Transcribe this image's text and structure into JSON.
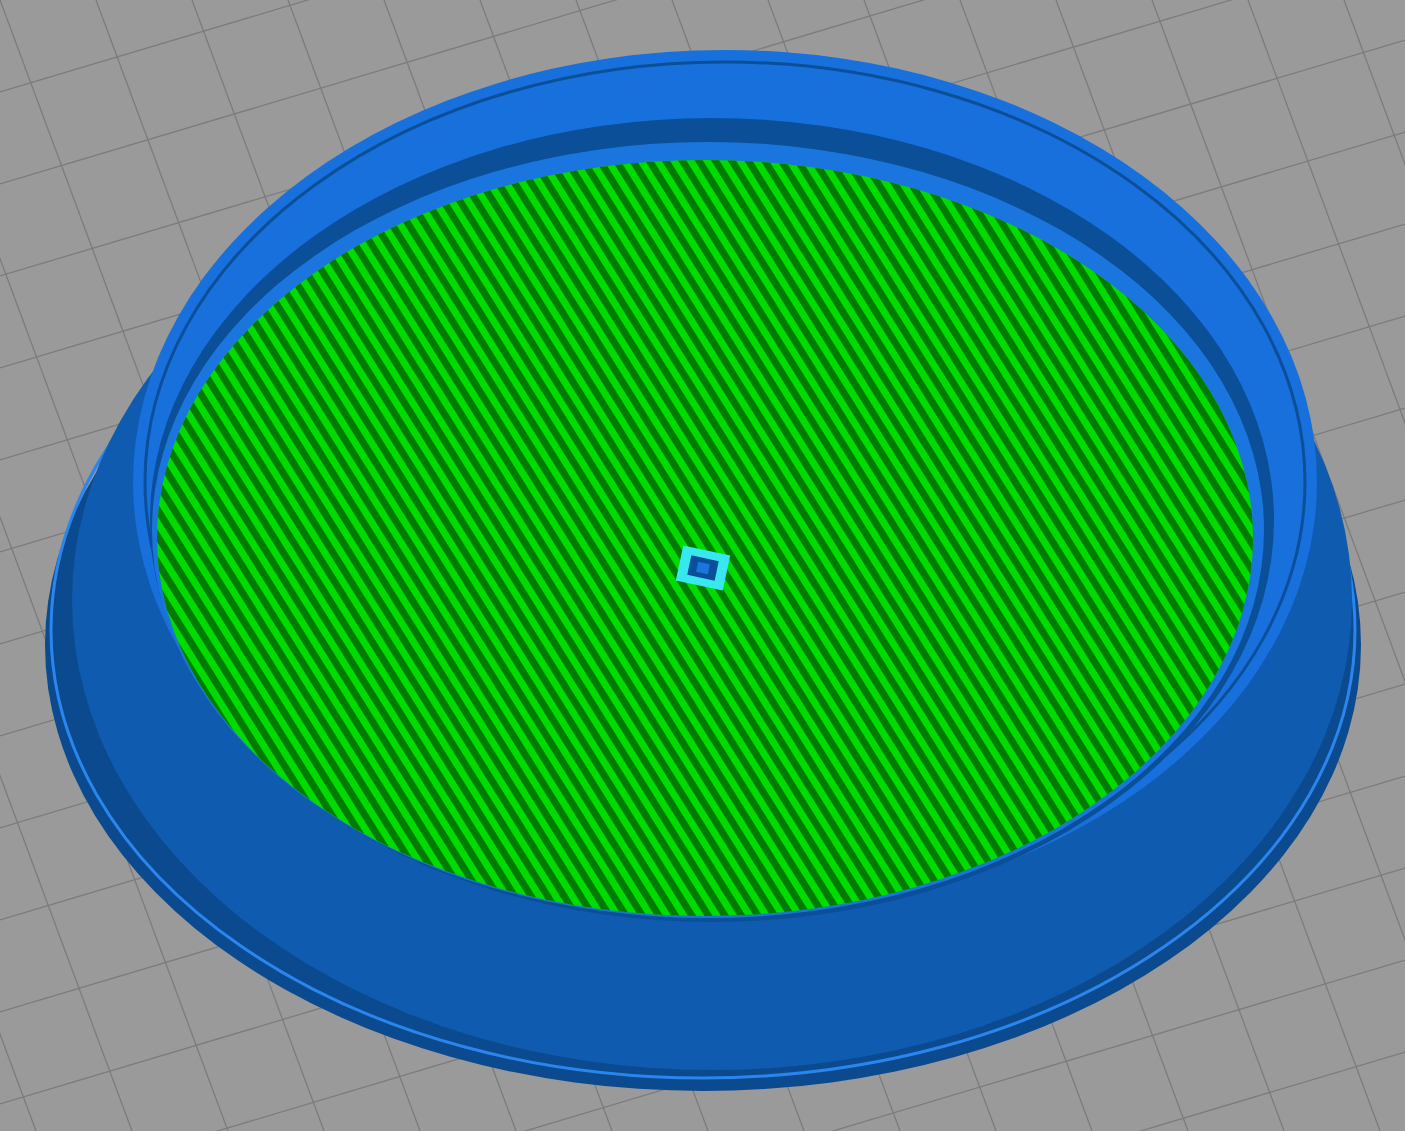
{
  "scene": {
    "regions": [
      {
        "kind": "wall",
        "color": "#1770dc"
      },
      {
        "kind": "infill",
        "color": "#00dc00"
      },
      {
        "kind": "top",
        "color": "#38e8f0"
      }
    ]
  }
}
